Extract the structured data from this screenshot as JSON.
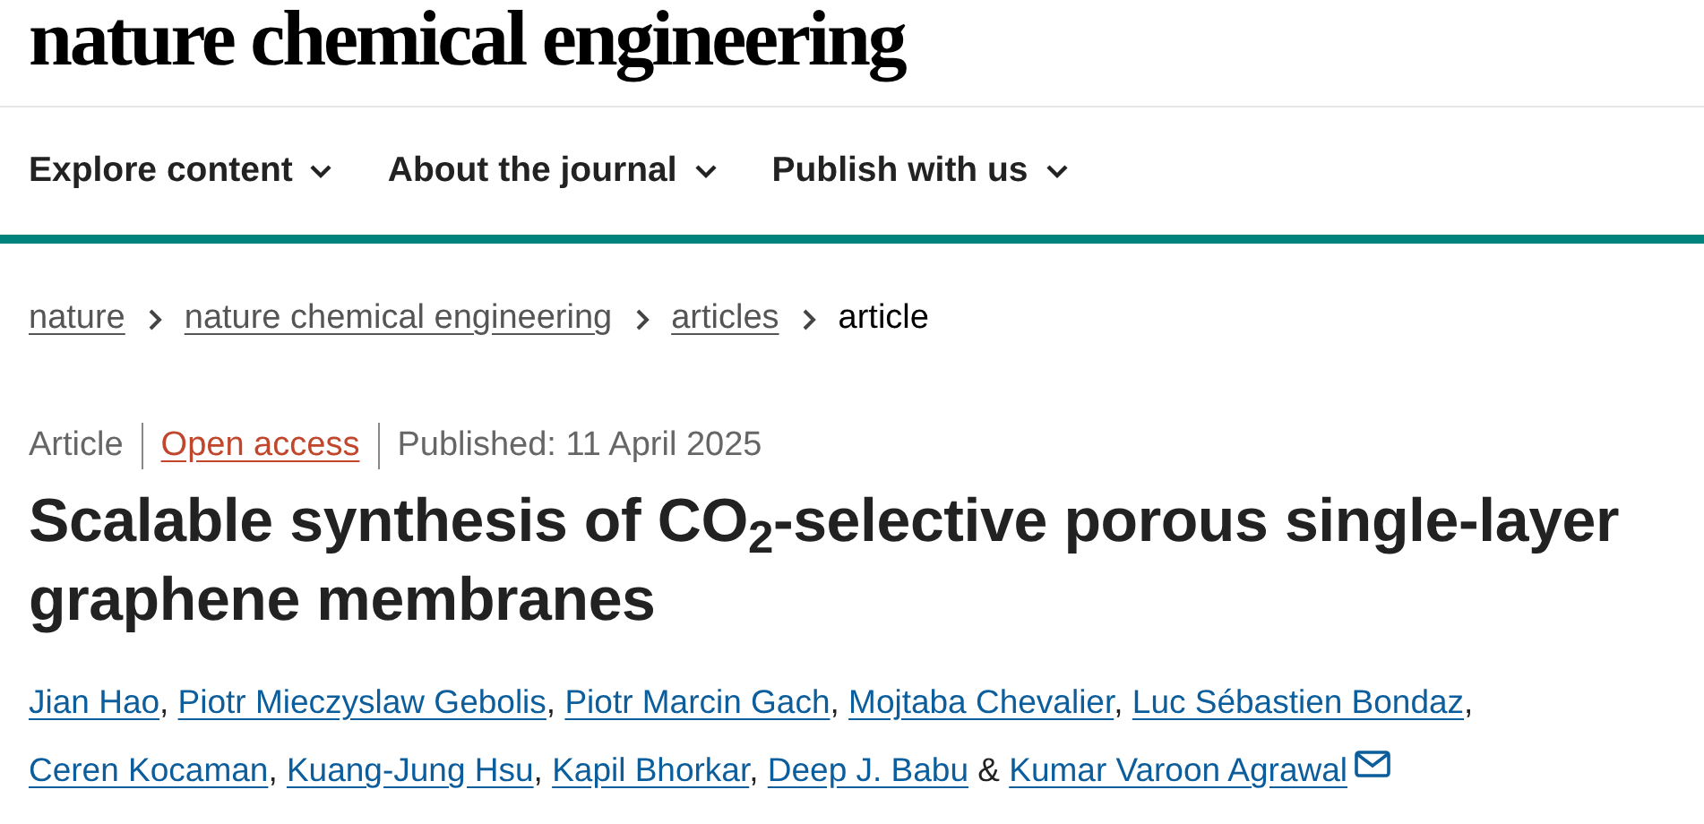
{
  "site": {
    "logo": "nature chemical engineering"
  },
  "nav": [
    {
      "label": "Explore content"
    },
    {
      "label": "About the journal"
    },
    {
      "label": "Publish with us"
    }
  ],
  "breadcrumbs": [
    {
      "label": "nature",
      "kind": "link"
    },
    {
      "label": "nature chemical engineering",
      "kind": "link"
    },
    {
      "label": "articles",
      "kind": "link"
    },
    {
      "label": "article",
      "kind": "current"
    }
  ],
  "meta": {
    "type": "Article",
    "access": "Open access",
    "published": "Published: 11 April 2025"
  },
  "title": "Scalable synthesis of CO$_{2}$-selective porous single-layer graphene membranes",
  "authors": [
    {
      "name": "Jian Hao",
      "corresponding": false
    },
    {
      "name": "Piotr Mieczyslaw Gebolis",
      "corresponding": false
    },
    {
      "name": "Piotr Marcin Gach",
      "corresponding": false
    },
    {
      "name": "Mojtaba Chevalier",
      "corresponding": false
    },
    {
      "name": "Luc Sébastien Bondaz",
      "corresponding": false
    },
    {
      "name": "Ceren Kocaman",
      "corresponding": false
    },
    {
      "name": "Kuang-Jung Hsu",
      "corresponding": false
    },
    {
      "name": "Kapil Bhorkar",
      "corresponding": false
    },
    {
      "name": "Deep J. Babu",
      "corresponding": false
    },
    {
      "name": "Kumar Varoon Agrawal",
      "corresponding": true
    }
  ],
  "author_separator": ",",
  "author_last_separator": "&"
}
